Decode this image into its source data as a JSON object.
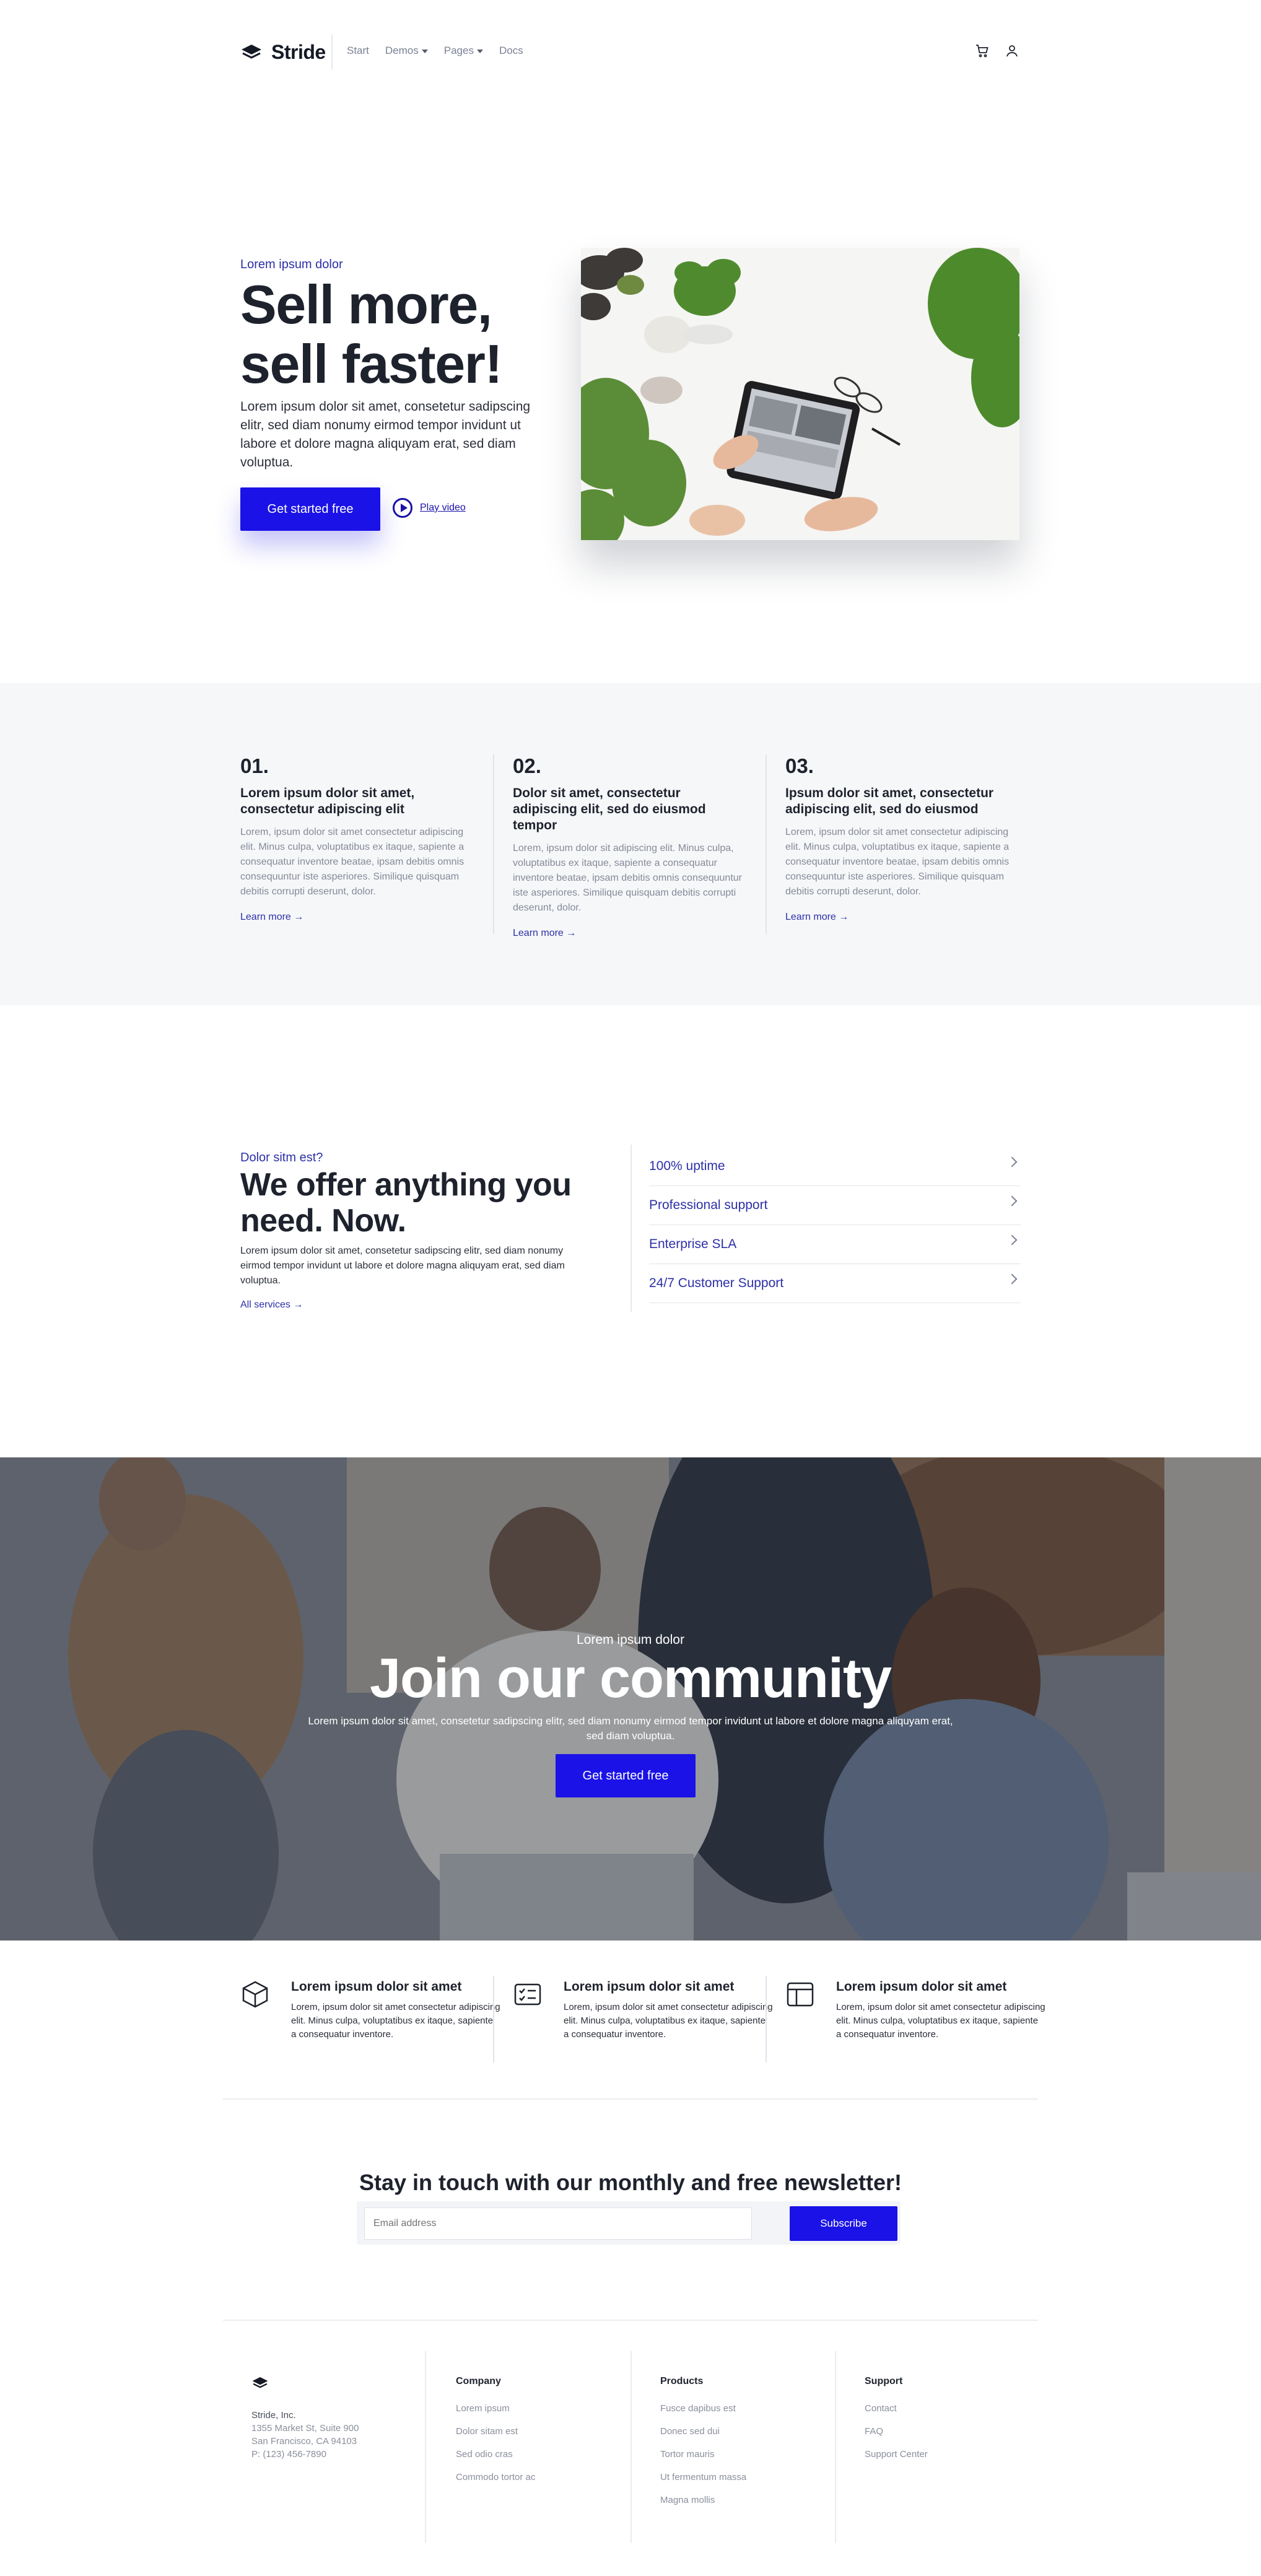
{
  "brand": {
    "name": "Stride"
  },
  "nav": {
    "links": [
      {
        "label": "Start"
      },
      {
        "label": "Demos"
      },
      {
        "label": "Pages"
      },
      {
        "label": "Docs"
      }
    ]
  },
  "hero": {
    "kicker": "Lorem ipsum dolor",
    "title_line1": "Sell more,",
    "title_line2": "sell faster!",
    "text": "Lorem ipsum dolor sit amet, consetetur sadipscing elitr, sed diam nonumy eirmod tempor invidunt ut labore et dolore magna aliquyam erat, sed diam voluptua.",
    "cta": "Get started free",
    "play_label": "Play video"
  },
  "steps": [
    {
      "num": "01.",
      "title": "Lorem ipsum dolor sit amet, consectetur adipiscing elit",
      "text": "Lorem, ipsum dolor sit amet consectetur adipiscing elit. Minus culpa, voluptatibus ex itaque, sapiente a consequatur inventore beatae, ipsam debitis omnis consequuntur iste asperiores. Similique quisquam debitis corrupti deserunt, dolor.",
      "link": "Learn more →"
    },
    {
      "num": "02.",
      "title": "Dolor sit amet, consectetur adipiscing elit, sed do eiusmod tempor",
      "text": "Lorem, ipsum dolor sit adipiscing elit. Minus culpa, voluptatibus ex itaque, sapiente a consequatur inventore beatae, ipsam debitis omnis consequuntur iste asperiores. Similique quisquam debitis corrupti deserunt, dolor.",
      "link": "Learn more →"
    },
    {
      "num": "03.",
      "title": "Ipsum dolor sit amet, consectetur adipiscing elit, sed do eiusmod",
      "text": "Lorem, ipsum dolor sit amet consectetur adipiscing elit. Minus culpa, voluptatibus ex itaque, sapiente a consequatur inventore beatae, ipsam debitis omnis consequuntur iste asperiores. Similique quisquam debitis corrupti deserunt, dolor.",
      "link": "Learn more →"
    }
  ],
  "services": {
    "kicker": "Dolor sitm est?",
    "title": "We offer anything you need. Now.",
    "text": "Lorem ipsum dolor sit amet, consetetur sadipscing elitr, sed diam nonumy eirmod tempor invidunt ut labore et dolore magna aliquyam erat, sed diam voluptua.",
    "link": "All services →",
    "items": [
      {
        "label": "100% uptime"
      },
      {
        "label": "Professional support"
      },
      {
        "label": "Enterprise SLA"
      },
      {
        "label": "24/7 Customer Support"
      }
    ]
  },
  "community": {
    "kicker": "Lorem ipsum dolor",
    "title": "Join our community",
    "text": "Lorem ipsum dolor sit amet, consetetur sadipscing elitr, sed diam nonumy eirmod tempor invidunt ut labore et dolore magna aliquyam erat, sed diam voluptua.",
    "cta": "Get started free"
  },
  "features": [
    {
      "icon": "box-icon",
      "title": "Lorem ipsum dolor sit amet",
      "text": "Lorem, ipsum dolor sit amet consectetur adipiscing elit. Minus culpa, voluptatibus ex itaque, sapiente a consequatur inventore."
    },
    {
      "icon": "checklist-icon",
      "title": "Lorem ipsum dolor sit amet",
      "text": "Lorem, ipsum dolor sit amet consectetur adipiscing elit. Minus culpa, voluptatibus ex itaque, sapiente a consequatur inventore."
    },
    {
      "icon": "layout-icon",
      "title": "Lorem ipsum dolor sit amet",
      "text": "Lorem, ipsum dolor sit amet consectetur adipiscing elit. Minus culpa, voluptatibus ex itaque, sapiente a consequatur inventore."
    }
  ],
  "newsletter": {
    "title_pre": "Stay in touch with our ",
    "title_bold": "monthly and free",
    "title_post": " newsletter!",
    "placeholder": "Email address",
    "button": "Subscribe"
  },
  "footer": {
    "company_name": "Stride, Inc.",
    "address1": "1355 Market St, Suite 900",
    "address2": "San Francisco, CA 94103",
    "phone": "P: (123) 456-7890",
    "columns": [
      {
        "title": "Company",
        "links": [
          "Lorem ipsum",
          "Dolor sitam est",
          "Sed odio cras",
          "Commodo tortor ac"
        ]
      },
      {
        "title": "Products",
        "links": [
          "Fusce dapibus est",
          "Donec sed dui",
          "Tortor mauris",
          "Ut fermentum massa",
          "Magna mollis"
        ]
      },
      {
        "title": "Support",
        "links": [
          "Contact",
          "FAQ",
          "Support Center"
        ]
      }
    ]
  },
  "colors": {
    "accent": "#1a12e6",
    "link": "#2c2fa8",
    "text": "#1e222d",
    "muted": "#858a98",
    "band": "#f6f7f9"
  }
}
